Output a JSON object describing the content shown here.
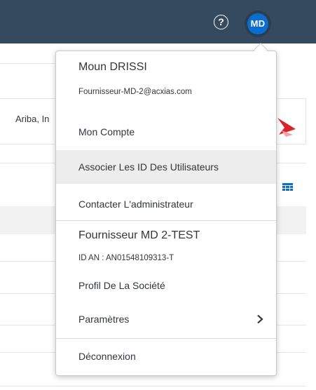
{
  "topbar": {
    "help_icon_glyph": "?",
    "avatar_initials": "MD"
  },
  "background": {
    "partial_company_text": "Ariba, In"
  },
  "menu": {
    "user_name": "Moun DRISSI",
    "user_email": "Fournisseur-MD-2@acxias.com",
    "items": [
      {
        "label": "Mon Compte"
      },
      {
        "label": "Associer Les ID Des Utilisateurs",
        "highlighted": true
      },
      {
        "label": "Contacter L'administrateur"
      }
    ],
    "company_name": "Fournisseur MD 2-TEST",
    "an_id": "ID AN : AN01548109313-T",
    "company_items": [
      {
        "label": "Profil De La Société"
      },
      {
        "label": "Paramètres",
        "has_submenu": true
      }
    ],
    "logout_label": "Déconnexion"
  },
  "colors": {
    "topbar": "#354a5f",
    "avatar": "#0a6ed1",
    "highlight": "#ededed"
  }
}
